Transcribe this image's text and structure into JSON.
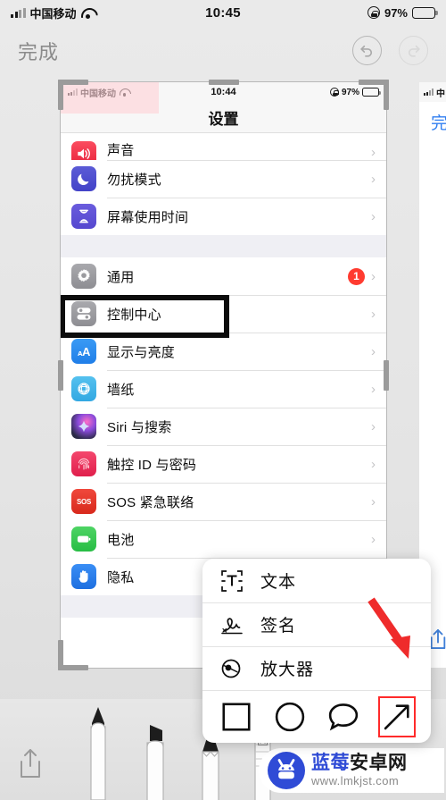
{
  "outer_status": {
    "carrier": "中国移动",
    "time": "10:45",
    "battery_pct": "97%",
    "signal_icon": "signal-bars-icon",
    "wifi_icon": "wifi-icon",
    "lock_icon": "rotation-lock-icon",
    "battery_icon": "battery-icon"
  },
  "markup_toolbar": {
    "done_label": "完成",
    "undo_icon": "undo-icon",
    "redo_icon": "redo-icon"
  },
  "screenshot": {
    "status": {
      "carrier": "中国移动",
      "time": "10:44",
      "battery_pct": "97%"
    },
    "nav_title": "设置",
    "rows": [
      {
        "label": "声音",
        "icon": "sound-icon",
        "accessory": "chevron-right-icon"
      },
      {
        "label": "勿扰模式",
        "icon": "moon-icon",
        "accessory": "chevron-right-icon"
      },
      {
        "label": "屏幕使用时间",
        "icon": "hourglass-icon",
        "accessory": "chevron-right-icon"
      },
      {
        "label": "通用",
        "icon": "gear-icon",
        "accessory": "chevron-right-icon",
        "badge": "1"
      },
      {
        "label": "控制中心",
        "icon": "control-center-icon",
        "accessory": "chevron-right-icon",
        "highlighted": true
      },
      {
        "label": "显示与亮度",
        "icon": "display-brightness-icon",
        "accessory": "chevron-right-icon"
      },
      {
        "label": "墙纸",
        "icon": "wallpaper-icon",
        "accessory": "chevron-right-icon"
      },
      {
        "label": "Siri 与搜索",
        "icon": "siri-icon",
        "accessory": "chevron-right-icon"
      },
      {
        "label": "触控 ID 与密码",
        "icon": "fingerprint-icon",
        "accessory": "chevron-right-icon"
      },
      {
        "label": "SOS 紧急联络",
        "icon": "sos-icon",
        "accessory": "chevron-right-icon"
      },
      {
        "label": "电池",
        "icon": "battery-settings-icon",
        "accessory": "chevron-right-icon"
      },
      {
        "label": "隐私",
        "icon": "privacy-hand-icon",
        "accessory": "chevron-right-icon"
      }
    ]
  },
  "next_page_peek": {
    "carrier_fragment": "中",
    "done_label": "完"
  },
  "popup_menu": {
    "items": [
      {
        "label": "文本",
        "icon": "text-box-icon"
      },
      {
        "label": "签名",
        "icon": "signature-icon"
      },
      {
        "label": "放大器",
        "icon": "magnifier-icon"
      }
    ],
    "shapes": [
      {
        "name": "square-shape",
        "selected": false
      },
      {
        "name": "circle-shape",
        "selected": false
      },
      {
        "name": "bubble-shape",
        "selected": false
      },
      {
        "name": "arrow-shape",
        "selected": true
      }
    ]
  },
  "annotations": {
    "highlight_box_color": "#0c0c0c",
    "red_arrow_color": "#ef2b2b",
    "shape_select_color": "#ff2a2a"
  },
  "bottom_toolbar": {
    "share_icon": "share-icon",
    "tools": [
      "pen-tool",
      "highlighter-tool",
      "pencil-tool",
      "eraser-tool"
    ]
  },
  "watermark": {
    "title_blue": "蓝莓",
    "title_black": "安卓网",
    "url": "www.lmkjst.com",
    "logo_icon": "android-mascot-icon",
    "brand_color": "#2f4bd6"
  }
}
